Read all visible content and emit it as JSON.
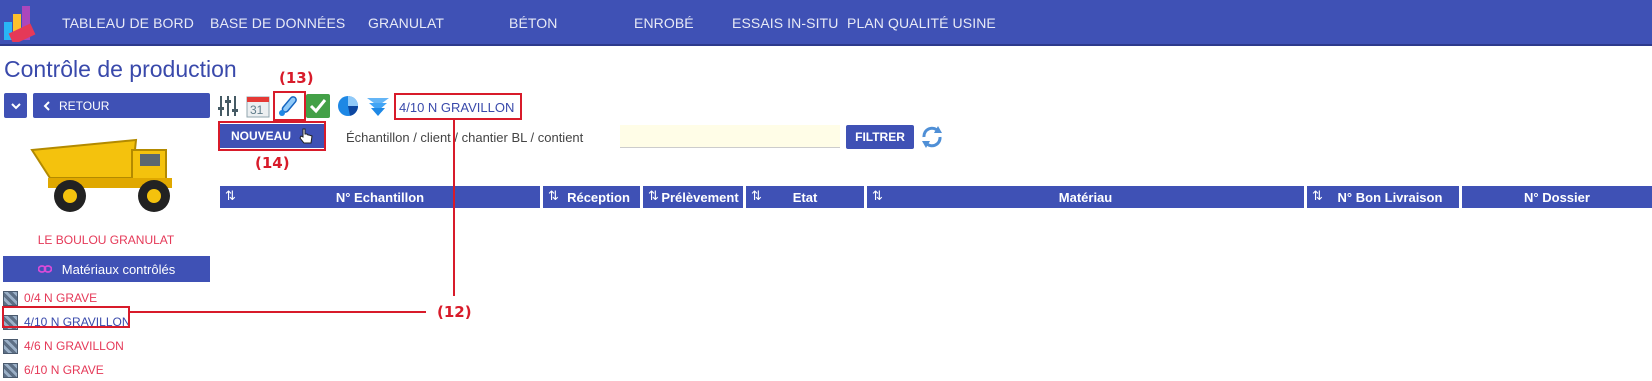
{
  "nav": {
    "items": [
      "TABLEAU DE BORD",
      "BASE DE DONNÉES",
      "GRANULAT",
      "BÉTON",
      "ENROBÉ",
      "ESSAIS IN-SITU",
      "PLAN QUALITÉ USINE"
    ]
  },
  "page": {
    "title": "Contrôle de production"
  },
  "sidebar": {
    "retour_label": "RETOUR",
    "site_name": "LE BOULOU GRANULAT",
    "materials_header": "Matériaux contrôlés",
    "materials": [
      "0/4 N GRAVE",
      "4/10 N GRAVILLON",
      "4/6 N GRAVILLON",
      "6/10 N GRAVE"
    ],
    "selected_index": 1
  },
  "toolbar": {
    "calendar_day": "31",
    "selected_sample": "4/10 N GRAVILLON",
    "nouveau_label": "NOUVEAU",
    "filter_label": "Échantillon / client / chantier BL / contient",
    "filter_value": "",
    "filtrer_label": "FILTRER"
  },
  "table": {
    "columns": [
      "N° Echantillon",
      "Réception",
      "Prélèvement",
      "Etat",
      "Matériau",
      "N° Bon Livraison",
      "N° Dossier"
    ]
  },
  "annotations": {
    "a12": "(12)",
    "a13": "(13)",
    "a14": "(14)"
  },
  "colors": {
    "primary": "#3f51b5",
    "accent_text": "#e53958",
    "annotation": "#d81b2a"
  }
}
